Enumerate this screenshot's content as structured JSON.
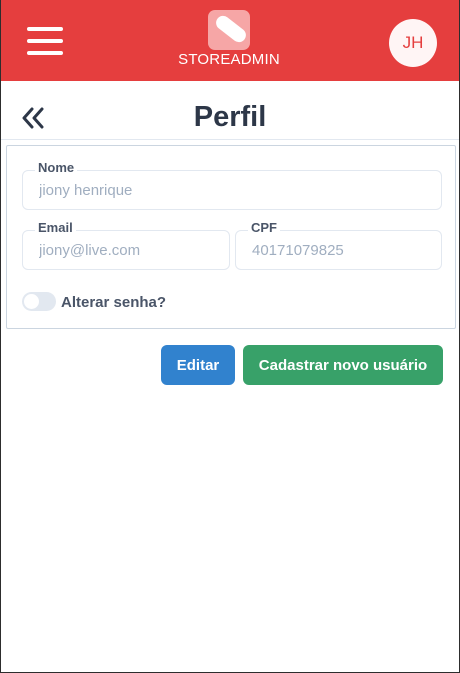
{
  "header": {
    "brand_name": "STOREADMIN",
    "avatar_initials": "JH",
    "colors": {
      "bar": "#e53e3e",
      "avatar_bg": "#fff5f5",
      "avatar_text": "#e53e3e"
    },
    "icons": {
      "menu": "hamburger-menu-icon",
      "logo": "store-tag-logo-icon"
    }
  },
  "page": {
    "title": "Perfil",
    "back_icon": "double-chevron-left-icon"
  },
  "profile_form": {
    "name": {
      "label": "Nome",
      "value": "jiony henrique"
    },
    "email": {
      "label": "Email",
      "value": "jiony@live.com"
    },
    "cpf": {
      "label": "CPF",
      "value": "40171079825"
    },
    "change_password": {
      "label": "Alterar senha?",
      "checked": false
    }
  },
  "actions": {
    "edit_label": "Editar",
    "new_user_label": "Cadastrar novo usuário",
    "colors": {
      "edit": "#3182ce",
      "new_user": "#38a169"
    }
  }
}
